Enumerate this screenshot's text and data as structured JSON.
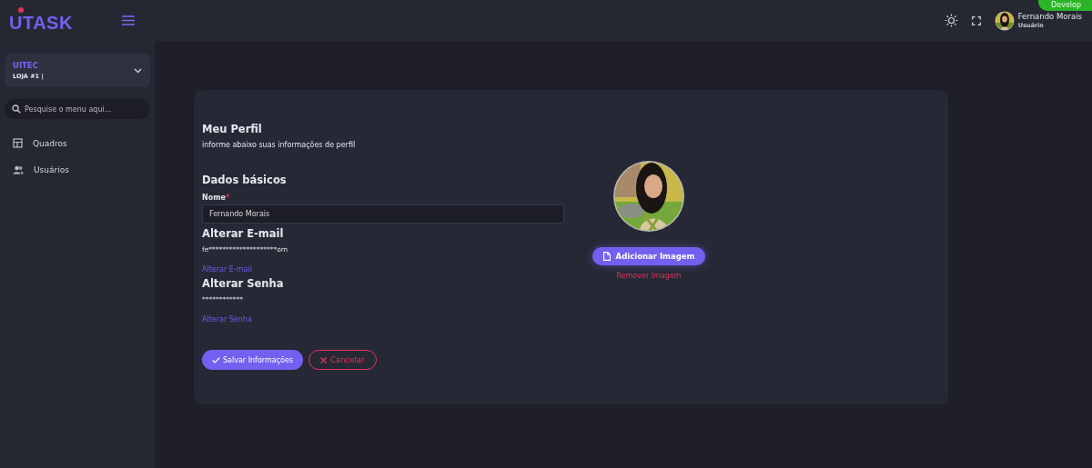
{
  "sidebar": {
    "logo": "UTASK",
    "company": {
      "name": "UITEC",
      "store": "LOJA #1 |"
    },
    "search": {
      "placeholder": "Pesquise o menu aqui..."
    },
    "items": [
      {
        "label": "Quadros",
        "kind": "board"
      },
      {
        "label": "Usuários",
        "kind": "users"
      }
    ]
  },
  "topbar": {
    "badge": "Develop",
    "user": {
      "name": "Fernando Morais",
      "role": "Usuário"
    }
  },
  "profile": {
    "title": "Meu Perfil",
    "subtitle": "informe abaixo suas informações de perfil",
    "basic_title": "Dados básicos",
    "name_label": "Nome",
    "required_mark": "*",
    "name_value": "Fernando Morais",
    "email_title": "Alterar E-mail",
    "email_masked": "fe********************om",
    "email_link": "Alterar E-mail",
    "password_title": "Alterar Senha",
    "password_masked": "************",
    "password_link": "Alterar Senha",
    "add_image": "Adicionar Imagem",
    "remove_image": "Remover Imagem",
    "save": "Salvar Informações",
    "cancel": "Cancelar"
  }
}
